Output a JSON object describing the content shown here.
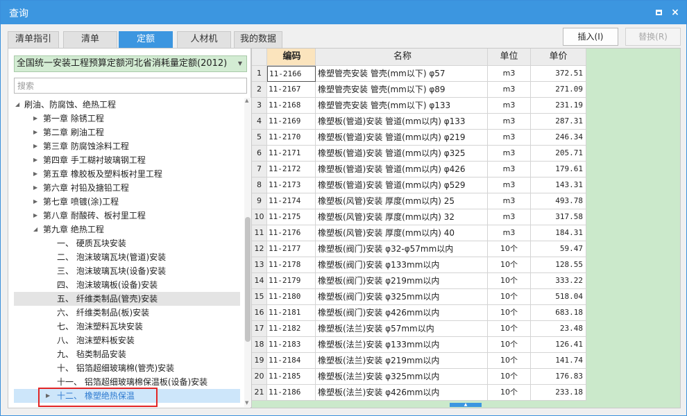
{
  "window": {
    "title": "查询",
    "maximize_icon": "maximize-icon",
    "close_label": "×"
  },
  "tabs": [
    {
      "label": "清单指引",
      "active": false
    },
    {
      "label": "清单",
      "active": false
    },
    {
      "label": "定额",
      "active": true
    },
    {
      "label": "人材机",
      "active": false
    },
    {
      "label": "我的数据",
      "active": false
    }
  ],
  "actions": {
    "insert_label": "插入(I)",
    "replace_label": "替换(R)"
  },
  "library": {
    "selected": "全国统一安装工程预算定额河北省消耗量定额(2012)"
  },
  "search": {
    "placeholder": "搜索"
  },
  "tree": [
    {
      "label": "刷油、防腐蚀、绝热工程",
      "toggle": "◢"
    },
    {
      "label": "第一章 除锈工程",
      "toggle": "▶"
    },
    {
      "label": "第二章 刷油工程",
      "toggle": "▶"
    },
    {
      "label": "第三章 防腐蚀涂料工程",
      "toggle": "▶"
    },
    {
      "label": "第四章 手工糊衬玻璃钢工程",
      "toggle": "▶"
    },
    {
      "label": "第五章 橡胶板及塑料板衬里工程",
      "toggle": "▶"
    },
    {
      "label": "第六章 衬铅及搪铅工程",
      "toggle": "▶"
    },
    {
      "label": "第七章 喷镀(涂)工程",
      "toggle": "▶"
    },
    {
      "label": "第八章 耐酸砖、板衬里工程",
      "toggle": "▶"
    },
    {
      "label": "第九章 绝热工程",
      "toggle": "◢"
    },
    {
      "label": "一、 硬质瓦块安装",
      "toggle": ""
    },
    {
      "label": "二、 泡沫玻璃瓦块(管道)安装",
      "toggle": ""
    },
    {
      "label": "三、 泡沫玻璃瓦块(设备)安装",
      "toggle": ""
    },
    {
      "label": "四、 泡沫玻璃板(设备)安装",
      "toggle": ""
    },
    {
      "label": "五、 纤维类制品(管壳)安装",
      "toggle": ""
    },
    {
      "label": "六、 纤维类制品(板)安装",
      "toggle": ""
    },
    {
      "label": "七、 泡沫塑料瓦块安装",
      "toggle": ""
    },
    {
      "label": "八、 泡沫塑料板安装",
      "toggle": ""
    },
    {
      "label": "九、 毡类制品安装",
      "toggle": ""
    },
    {
      "label": "十、 铝箔超细玻璃棉(管壳)安装",
      "toggle": ""
    },
    {
      "label": "十一、 铝箔超细玻璃棉保温板(设备)安装",
      "toggle": ""
    },
    {
      "label": "十二、 橡塑绝热保温",
      "toggle": "▶"
    }
  ],
  "table": {
    "headers": {
      "code": "编码",
      "name": "名称",
      "unit": "单位",
      "price": "单价"
    },
    "rows": [
      {
        "idx": "1",
        "code": "11-2166",
        "name": "橡塑管壳安装 管壳(mm以下) φ57",
        "unit": "m3",
        "price": "372.51"
      },
      {
        "idx": "2",
        "code": "11-2167",
        "name": "橡塑管壳安装 管壳(mm以下) φ89",
        "unit": "m3",
        "price": "271.09"
      },
      {
        "idx": "3",
        "code": "11-2168",
        "name": "橡塑管壳安装 管壳(mm以下) φ133",
        "unit": "m3",
        "price": "231.19"
      },
      {
        "idx": "4",
        "code": "11-2169",
        "name": "橡塑板(管道)安装 管道(mm以内) φ133",
        "unit": "m3",
        "price": "287.31"
      },
      {
        "idx": "5",
        "code": "11-2170",
        "name": "橡塑板(管道)安装 管道(mm以内) φ219",
        "unit": "m3",
        "price": "246.34"
      },
      {
        "idx": "6",
        "code": "11-2171",
        "name": "橡塑板(管道)安装 管道(mm以内) φ325",
        "unit": "m3",
        "price": "205.71"
      },
      {
        "idx": "7",
        "code": "11-2172",
        "name": "橡塑板(管道)安装 管道(mm以内) φ426",
        "unit": "m3",
        "price": "179.61"
      },
      {
        "idx": "8",
        "code": "11-2173",
        "name": "橡塑板(管道)安装 管道(mm以内) φ529",
        "unit": "m3",
        "price": "143.31"
      },
      {
        "idx": "9",
        "code": "11-2174",
        "name": "橡塑板(风管)安装 厚度(mm以内) 25",
        "unit": "m3",
        "price": "493.78"
      },
      {
        "idx": "10",
        "code": "11-2175",
        "name": "橡塑板(风管)安装 厚度(mm以内) 32",
        "unit": "m3",
        "price": "317.58"
      },
      {
        "idx": "11",
        "code": "11-2176",
        "name": "橡塑板(风管)安装 厚度(mm以内) 40",
        "unit": "m3",
        "price": "184.31"
      },
      {
        "idx": "12",
        "code": "11-2177",
        "name": "橡塑板(阀门)安装 φ32-φ57mm以内",
        "unit": "10个",
        "price": "59.47"
      },
      {
        "idx": "13",
        "code": "11-2178",
        "name": "橡塑板(阀门)安装 φ133mm以内",
        "unit": "10个",
        "price": "128.55"
      },
      {
        "idx": "14",
        "code": "11-2179",
        "name": "橡塑板(阀门)安装 φ219mm以内",
        "unit": "10个",
        "price": "333.22"
      },
      {
        "idx": "15",
        "code": "11-2180",
        "name": "橡塑板(阀门)安装 φ325mm以内",
        "unit": "10个",
        "price": "518.04"
      },
      {
        "idx": "16",
        "code": "11-2181",
        "name": "橡塑板(阀门)安装 φ426mm以内",
        "unit": "10个",
        "price": "683.18"
      },
      {
        "idx": "17",
        "code": "11-2182",
        "name": "橡塑板(法兰)安装 φ57mm以内",
        "unit": "10个",
        "price": "23.48"
      },
      {
        "idx": "18",
        "code": "11-2183",
        "name": "橡塑板(法兰)安装 φ133mm以内",
        "unit": "10个",
        "price": "126.41"
      },
      {
        "idx": "19",
        "code": "11-2184",
        "name": "橡塑板(法兰)安装 φ219mm以内",
        "unit": "10个",
        "price": "141.74"
      },
      {
        "idx": "20",
        "code": "11-2185",
        "name": "橡塑板(法兰)安装 φ325mm以内",
        "unit": "10个",
        "price": "176.83"
      },
      {
        "idx": "21",
        "code": "11-2186",
        "name": "橡塑板(法兰)安装 φ426mm以内",
        "unit": "10个",
        "price": "233.18"
      }
    ]
  },
  "colors": {
    "accent": "#3c96e0",
    "selection_bg": "#cde6fa",
    "library_bg": "#d3ecd3",
    "grid_empty_bg": "#cbe9cb",
    "header_code_bg": "#fbe4bd",
    "highlight_frame": "#e22424"
  }
}
